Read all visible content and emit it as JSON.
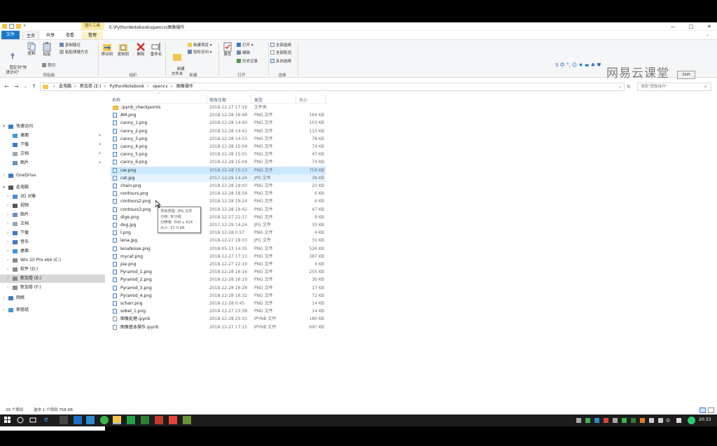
{
  "window": {
    "title_path": "E:\\PythonNotebook\\opencv\\图像操作",
    "context_tab": "图片工具",
    "controls": {
      "minimize": "—",
      "maximize": "□",
      "close": "✕"
    }
  },
  "ribbon_tabs": [
    "文件",
    "主页",
    "共享",
    "查看",
    "管理"
  ],
  "ribbon": {
    "clipboard": {
      "pin_label": "固定到\"快\n速访问\"",
      "copy": "复制",
      "paste": "粘贴",
      "copy_path": "复制路径",
      "paste_shortcut": "粘贴快捷方式",
      "cut": "剪切",
      "group": "剪贴板"
    },
    "organize": {
      "move_to": "移动到",
      "copy_to": "复制到",
      "delete": "删除",
      "rename": "重命名",
      "group": "组织"
    },
    "new": {
      "new_folder": "新建\n文件夹",
      "new_item": "新建项目 ▾",
      "easy_access": "轻松访问 ▾",
      "group": "新建"
    },
    "open": {
      "properties": "属性",
      "open": "打开 ▾",
      "edit": "编辑",
      "history": "历史记录",
      "group": "打开"
    },
    "select": {
      "select_all": "全部选择",
      "select_none": "全部取消",
      "invert": "反向选择",
      "group": "选择"
    }
  },
  "overlay": {
    "watermark": "网易云课堂",
    "ime": "S 中 °, ☺ ♦ ▬ ♣ ♥",
    "share_button": "Shift"
  },
  "address": {
    "crumbs": [
      "此电脑",
      "新加卷 (E:)",
      "PythonNotebook",
      "opencv",
      "图像操作"
    ],
    "search_placeholder": "搜索\"图像操作\""
  },
  "nav_pane": [
    {
      "label": "快速访问",
      "icon": "star-icon",
      "level": 0,
      "exp": "▾"
    },
    {
      "label": "桌面",
      "icon": "desktop-icon",
      "level": 1,
      "pin": true
    },
    {
      "label": "下载",
      "icon": "download-icon",
      "level": 1,
      "pin": true
    },
    {
      "label": "文档",
      "icon": "document-icon",
      "level": 1,
      "pin": true
    },
    {
      "label": "图片",
      "icon": "picture-icon",
      "level": 1,
      "pin": true
    },
    {
      "label": "OneDrive",
      "icon": "cloud-icon",
      "level": 0,
      "exp": "›"
    },
    {
      "label": "此电脑",
      "icon": "computer-icon",
      "level": 0,
      "exp": "▾"
    },
    {
      "label": "3D 对象",
      "icon": "cube-icon",
      "level": 1,
      "exp": "›"
    },
    {
      "label": "视频",
      "icon": "video-icon",
      "level": 1,
      "exp": "›"
    },
    {
      "label": "图片",
      "icon": "picture-icon",
      "level": 1,
      "exp": "›"
    },
    {
      "label": "文档",
      "icon": "document-icon",
      "level": 1,
      "exp": "›"
    },
    {
      "label": "下载",
      "icon": "download-icon",
      "level": 1,
      "exp": "›"
    },
    {
      "label": "音乐",
      "icon": "music-icon",
      "level": 1,
      "exp": "›"
    },
    {
      "label": "桌面",
      "icon": "desktop-icon",
      "level": 1,
      "exp": "›"
    },
    {
      "label": "Win 10 Pro x64 (C:)",
      "icon": "drive-icon",
      "level": 1,
      "exp": "›"
    },
    {
      "label": "软件 (D:)",
      "icon": "drive-icon",
      "level": 1,
      "exp": "›"
    },
    {
      "label": "新加卷 (E:)",
      "icon": "drive-icon",
      "level": 1,
      "exp": "›",
      "selected": true
    },
    {
      "label": "新加卷 (F:)",
      "icon": "drive-icon",
      "level": 1,
      "exp": "›"
    },
    {
      "label": "网络",
      "icon": "network-icon",
      "level": 0,
      "exp": "›"
    },
    {
      "label": "家庭组",
      "icon": "homegroup-icon",
      "level": 0,
      "exp": "›"
    }
  ],
  "columns": {
    "name": "名称",
    "date": "修改日期",
    "type": "类型",
    "size": "大小"
  },
  "files": [
    {
      "name": ".ipynb_checkpoints",
      "date": "2018-12-27 17:19",
      "type": "文件夹",
      "size": "",
      "kind": "folder"
    },
    {
      "name": "AM.png",
      "date": "2018-12-28 16:48",
      "type": "PNG 文件",
      "size": "164 KB",
      "kind": "png"
    },
    {
      "name": "canny_1.png",
      "date": "2018-12-28 14:40",
      "type": "PNG 文件",
      "size": "103 KB",
      "kind": "png"
    },
    {
      "name": "canny_2.png",
      "date": "2018-12-28 14:41",
      "type": "PNG 文件",
      "size": "115 KB",
      "kind": "png"
    },
    {
      "name": "canny_3.png",
      "date": "2018-12-28 14:53",
      "type": "PNG 文件",
      "size": "78 KB",
      "kind": "png"
    },
    {
      "name": "canny_4.png",
      "date": "2018-12-28 15:04",
      "type": "PNG 文件",
      "size": "74 KB",
      "kind": "png"
    },
    {
      "name": "canny_5.png",
      "date": "2018-12-28 15:01",
      "type": "PNG 文件",
      "size": "47 KB",
      "kind": "png"
    },
    {
      "name": "canny_6.png",
      "date": "2018-12-28 15:04",
      "type": "PNG 文件",
      "size": "74 KB",
      "kind": "png"
    },
    {
      "name": "car.png",
      "date": "2018-12-28 15:13",
      "type": "PNG 文件",
      "size": "759 KB",
      "kind": "png",
      "selected": true
    },
    {
      "name": "cat.jpg",
      "date": "2017-12-29 14:24",
      "type": "JPG 文件",
      "size": "38 KB",
      "kind": "jpg",
      "hover": true
    },
    {
      "name": "chain.png",
      "date": "2018-12-28 19:03",
      "type": "PNG 文件",
      "size": "20 KB",
      "kind": "png"
    },
    {
      "name": "contours.png",
      "date": "2018-12-28 18:56",
      "type": "PNG 文件",
      "size": "6 KB",
      "kind": "png"
    },
    {
      "name": "contours2.png",
      "date": "2018-12-28 19:24",
      "type": "PNG 文件",
      "size": "4 KB",
      "kind": "png"
    },
    {
      "name": "contours3.png",
      "date": "2018-12-28 19:42",
      "type": "PNG 文件",
      "size": "47 KB",
      "kind": "png"
    },
    {
      "name": "dige.png",
      "date": "2018-12-27 22:17",
      "type": "PNG 文件",
      "size": "9 KB",
      "kind": "png"
    },
    {
      "name": "dog.jpg",
      "date": "2017-12-29 14:24",
      "type": "JPG 文件",
      "size": "33 KB",
      "kind": "jpg"
    },
    {
      "name": "l.png",
      "date": "2018-12-28 0:57",
      "type": "PNG 文件",
      "size": "4 KB",
      "kind": "png"
    },
    {
      "name": "lena.jpg",
      "date": "2018-12-27 18:03",
      "type": "JPG 文件",
      "size": "31 KB",
      "kind": "jpg"
    },
    {
      "name": "lenaNoise.png",
      "date": "2018-05-13 14:35",
      "type": "PNG 文件",
      "size": "526 KB",
      "kind": "png"
    },
    {
      "name": "mycat.png",
      "date": "2018-12-27 17:13",
      "type": "PNG 文件",
      "size": "387 KB",
      "kind": "png"
    },
    {
      "name": "pie.png",
      "date": "2018-12-27 22:19",
      "type": "PNG 文件",
      "size": "4 KB",
      "kind": "png"
    },
    {
      "name": "Pyramid_1.png",
      "date": "2018-12-28 16:16",
      "type": "PNG 文件",
      "size": "255 KB",
      "kind": "png"
    },
    {
      "name": "Pyramid_2.png",
      "date": "2018-12-28 16:19",
      "type": "PNG 文件",
      "size": "30 KB",
      "kind": "png"
    },
    {
      "name": "Pyramid_3.png",
      "date": "2018-12-28 16:28",
      "type": "PNG 文件",
      "size": "17 KB",
      "kind": "png"
    },
    {
      "name": "Pyramid_4.png",
      "date": "2018-12-28 16:32",
      "type": "PNG 文件",
      "size": "72 KB",
      "kind": "png"
    },
    {
      "name": "scharr.png",
      "date": "2018-12-28 0:45",
      "type": "PNG 文件",
      "size": "14 KB",
      "kind": "png"
    },
    {
      "name": "sobel_1.png",
      "date": "2018-12-27 23:39",
      "type": "PNG 文件",
      "size": "14 KB",
      "kind": "png"
    },
    {
      "name": "图像处理.ipynb",
      "date": "2018-12-28 20:33",
      "type": "IPYNB 文件",
      "size": "180 KB",
      "kind": "doc"
    },
    {
      "name": "图像基本操作.ipynb",
      "date": "2018-12-27 17:15",
      "type": "IPYNB 文件",
      "size": "697 KB",
      "kind": "doc"
    }
  ],
  "tooltip": {
    "line1": "项目类型: JPG 文件",
    "line2": "分级: 未分级",
    "line3": "分辨率: 500 x 414",
    "line4": "大小: 37.0 KB"
  },
  "status": {
    "count": "29 个项目",
    "selection": "选中 1 个项目  758 KB"
  },
  "taskbar": {
    "time": "20:33",
    "tray_lang": "中"
  },
  "colors": {
    "accent": "#1979ca",
    "selected_row": "#cce8ff",
    "taskbar": "#1c1c1c",
    "context_tab": "#f9e9a4"
  }
}
